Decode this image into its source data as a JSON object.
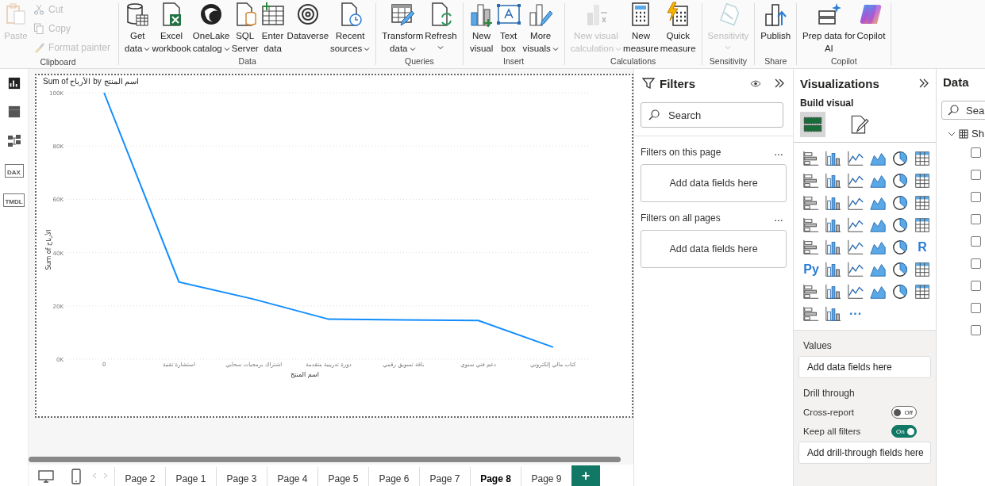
{
  "ribbon": {
    "groups": [
      {
        "name": "Clipboard",
        "buttons": [
          {
            "label": "Paste",
            "kind": "large",
            "disabled": true
          },
          {
            "label": "Cut",
            "kind": "small",
            "disabled": true
          },
          {
            "label": "Copy",
            "kind": "small",
            "disabled": true
          },
          {
            "label": "Format painter",
            "kind": "small",
            "disabled": true
          }
        ]
      },
      {
        "name": "Data",
        "buttons": [
          {
            "label": "Get\ndata",
            "kind": "large",
            "disabled": false,
            "menu": true
          },
          {
            "label": "Excel\nworkbook",
            "kind": "large",
            "disabled": false,
            "menu": false
          },
          {
            "label": "OneLake\ncatalog",
            "kind": "large",
            "disabled": false,
            "menu": true
          },
          {
            "label": "SQL\nServer",
            "kind": "large",
            "disabled": false,
            "menu": false
          },
          {
            "label": "Enter\ndata",
            "kind": "large",
            "disabled": false,
            "menu": false
          },
          {
            "label": "Dataverse",
            "kind": "large",
            "disabled": false,
            "menu": false
          },
          {
            "label": "Recent\nsources",
            "kind": "large",
            "disabled": false,
            "menu": true
          }
        ]
      },
      {
        "name": "Queries",
        "buttons": [
          {
            "label": "Transform\ndata",
            "kind": "large",
            "disabled": false,
            "menu": true
          },
          {
            "label": "Refresh",
            "kind": "large",
            "disabled": false,
            "menu": true,
            "menu_below": true
          }
        ]
      },
      {
        "name": "Insert",
        "buttons": [
          {
            "label": "New\nvisual",
            "kind": "large",
            "disabled": false,
            "menu": false
          },
          {
            "label": "Text\nbox",
            "kind": "large",
            "disabled": false,
            "menu": false
          },
          {
            "label": "More\nvisuals",
            "kind": "large",
            "disabled": false,
            "menu": true
          }
        ]
      },
      {
        "name": "Calculations",
        "buttons": [
          {
            "label": "New visual\ncalculation",
            "kind": "large",
            "disabled": true,
            "menu": true
          },
          {
            "label": "New\nmeasure",
            "kind": "large",
            "disabled": false,
            "menu": false
          },
          {
            "label": "Quick\nmeasure",
            "kind": "large",
            "disabled": false,
            "menu": false
          }
        ]
      },
      {
        "name": "Sensitivity",
        "buttons": [
          {
            "label": "Sensitivity",
            "kind": "large",
            "disabled": true,
            "menu": true,
            "menu_below": true
          }
        ]
      },
      {
        "name": "Share",
        "buttons": [
          {
            "label": "Publish",
            "kind": "large",
            "disabled": false,
            "menu": false
          }
        ]
      },
      {
        "name": "Copilot",
        "buttons": [
          {
            "label": "Prep data for\nAI",
            "kind": "large",
            "disabled": false,
            "menu": false
          },
          {
            "label": "Copilot",
            "kind": "large",
            "disabled": false,
            "menu": false
          }
        ]
      }
    ]
  },
  "view_rail": [
    {
      "selected": true
    },
    {
      "selected": false
    },
    {
      "selected": false
    },
    {
      "label": "DAX",
      "selected": false
    },
    {
      "label": "TMDL",
      "selected": false
    }
  ],
  "chart": {
    "chart_data": {
      "type": "line",
      "title": "Sum of الأرباح by اسم المنتج",
      "xlabel": "اسم المنتج",
      "ylabel": "Sum of الأرباح",
      "categories": [
        "0",
        "استشارة تقنية",
        "اشتراك برمجيات سحابي",
        "دورة تدريبية متقدمة",
        "باقة تسويق رقمي",
        "دعم فني سنوي",
        "كتاب مالي إلكتروني"
      ],
      "values": [
        100000,
        29000,
        22500,
        15000,
        14700,
        14500,
        4500
      ],
      "ylim": [
        0,
        100000
      ],
      "grid": true,
      "yticks": [
        {
          "value": 0,
          "label": "0K"
        },
        {
          "value": 20000,
          "label": "20K"
        },
        {
          "value": 40000,
          "label": "40K"
        },
        {
          "value": 60000,
          "label": "60K"
        },
        {
          "value": 80000,
          "label": "80K"
        },
        {
          "value": 100000,
          "label": "100K"
        }
      ]
    }
  },
  "page_tabs": [
    {
      "label": "Page 2",
      "selected": false
    },
    {
      "label": "Page 1",
      "selected": false
    },
    {
      "label": "Page 3",
      "selected": false
    },
    {
      "label": "Page 4",
      "selected": false
    },
    {
      "label": "Page 5",
      "selected": false
    },
    {
      "label": "Page 6",
      "selected": false
    },
    {
      "label": "Page 7",
      "selected": false
    },
    {
      "label": "Page 8",
      "selected": true
    },
    {
      "label": "Page 9",
      "selected": false
    }
  ],
  "add_page": "+",
  "filters": {
    "title": "Filters",
    "search": {
      "placeholder": "Search"
    },
    "sections": [
      {
        "title": "Filters on this page",
        "more": "…",
        "drop": "Add data fields here"
      },
      {
        "title": "Filters on all pages",
        "more": "…",
        "drop": "Add data fields here"
      }
    ]
  },
  "visualizations": {
    "title": "Visualizations",
    "subtitle": "Build visual",
    "tabs": [
      {
        "selected": true
      },
      {
        "selected": false
      }
    ],
    "gallery": [
      {
        "kind": "icon"
      },
      {
        "kind": "icon"
      },
      {
        "kind": "icon"
      },
      {
        "kind": "icon"
      },
      {
        "kind": "icon"
      },
      {
        "kind": "icon"
      },
      {
        "kind": "icon"
      },
      {
        "kind": "icon"
      },
      {
        "kind": "icon"
      },
      {
        "kind": "icon"
      },
      {
        "kind": "icon"
      },
      {
        "kind": "icon"
      },
      {
        "kind": "icon"
      },
      {
        "kind": "icon"
      },
      {
        "kind": "icon"
      },
      {
        "kind": "icon"
      },
      {
        "kind": "icon"
      },
      {
        "kind": "icon"
      },
      {
        "kind": "icon"
      },
      {
        "kind": "icon"
      },
      {
        "kind": "icon"
      },
      {
        "kind": "icon"
      },
      {
        "kind": "icon"
      },
      {
        "kind": "icon"
      },
      {
        "kind": "icon"
      },
      {
        "kind": "icon"
      },
      {
        "kind": "icon"
      },
      {
        "kind": "icon"
      },
      {
        "kind": "icon"
      },
      {
        "kind": "text",
        "label": "R"
      },
      {
        "kind": "text",
        "label": "Py"
      },
      {
        "kind": "icon"
      },
      {
        "kind": "icon"
      },
      {
        "kind": "icon"
      },
      {
        "kind": "icon"
      },
      {
        "kind": "icon"
      },
      {
        "kind": "icon"
      },
      {
        "kind": "icon"
      },
      {
        "kind": "icon"
      },
      {
        "kind": "icon"
      },
      {
        "kind": "icon"
      },
      {
        "kind": "icon"
      },
      {
        "kind": "icon"
      },
      {
        "kind": "icon"
      },
      {
        "kind": "text",
        "label": "···"
      }
    ],
    "values_title": "Values",
    "values_drop": "Add data fields here",
    "drill_title": "Drill through",
    "toggles": [
      {
        "label": "Cross-report",
        "on": false,
        "state_text": "Off"
      },
      {
        "label": "Keep all filters",
        "on": true,
        "state_text": "On"
      }
    ],
    "drill_drop": "Add drill-through fields here"
  },
  "data": {
    "title": "Data",
    "search": {
      "placeholder": "Sea"
    },
    "table": {
      "label": "Sh",
      "expanded": true,
      "fields": [
        {
          "checked": false
        },
        {
          "checked": false
        },
        {
          "checked": false
        },
        {
          "checked": false
        },
        {
          "checked": false
        },
        {
          "checked": false
        },
        {
          "checked": false
        },
        {
          "checked": false
        },
        {
          "checked": false
        }
      ]
    }
  }
}
